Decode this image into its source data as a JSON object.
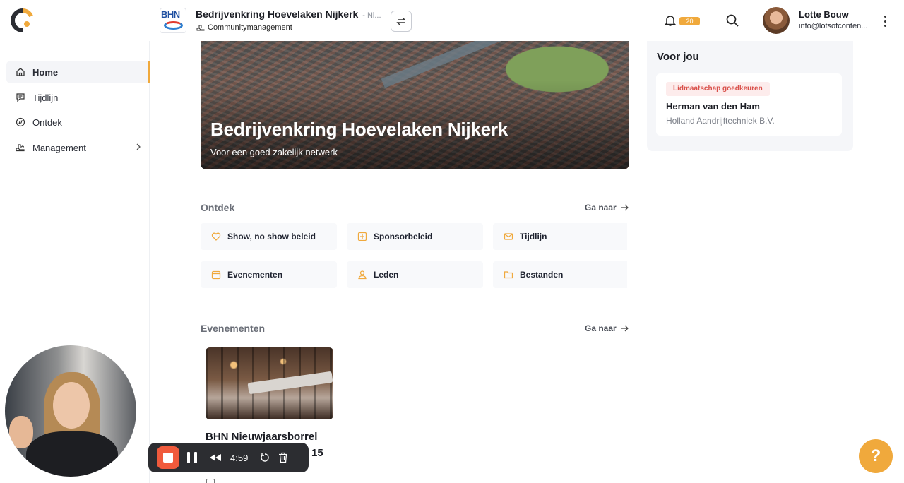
{
  "header": {
    "org_logo_text": "BHN",
    "org_title": "Bedrijvenkring Hoevelaken Nijkerk",
    "org_title_suffix": "- Ni...",
    "org_subtitle": "Communitymanagement",
    "notification_count": "20",
    "user_name": "Lotte Bouw",
    "user_email": "info@lotsofconten..."
  },
  "sidebar": {
    "items": [
      {
        "label": "Home",
        "icon": "home-icon",
        "active": true
      },
      {
        "label": "Tijdlijn",
        "icon": "chat-icon"
      },
      {
        "label": "Ontdek",
        "icon": "compass-icon"
      },
      {
        "label": "Management",
        "icon": "hand-icon",
        "has_submenu": true
      }
    ]
  },
  "hero": {
    "title": "Bedrijvenkring Hoevelaken Nijkerk",
    "subtitle": "Voor een goed zakelijk netwerk"
  },
  "ontdek": {
    "title": "Ontdek",
    "goto_label": "Ga naar",
    "tiles": [
      {
        "label": "Show, no show beleid",
        "icon": "heart-icon"
      },
      {
        "label": "Sponsorbeleid",
        "icon": "plus-square-icon"
      },
      {
        "label": "Tijdlijn",
        "icon": "mail-icon"
      },
      {
        "label": "Evenementen",
        "icon": "calendar-icon"
      },
      {
        "label": "Leden",
        "icon": "users-icon"
      },
      {
        "label": "Bestanden",
        "icon": "folder-icon"
      }
    ]
  },
  "evenementen": {
    "title": "Evenementen",
    "goto_label": "Ga naar",
    "event": {
      "title": "BHN Nieuwjaarsborrel",
      "date_fragment": "15"
    }
  },
  "voor_jou": {
    "title": "Voor jou",
    "card": {
      "badge": "Lidmaatschap goedkeuren",
      "name": "Herman van den Ham",
      "company": "Holland Aandrijftechniek B.V."
    }
  },
  "recorder": {
    "time": "4:59"
  },
  "help_label": "?",
  "colors": {
    "accent": "#f0a93c",
    "badge_bg": "#fdecec",
    "badge_text": "#d9504a",
    "recorder_stop": "#f05a3c"
  }
}
